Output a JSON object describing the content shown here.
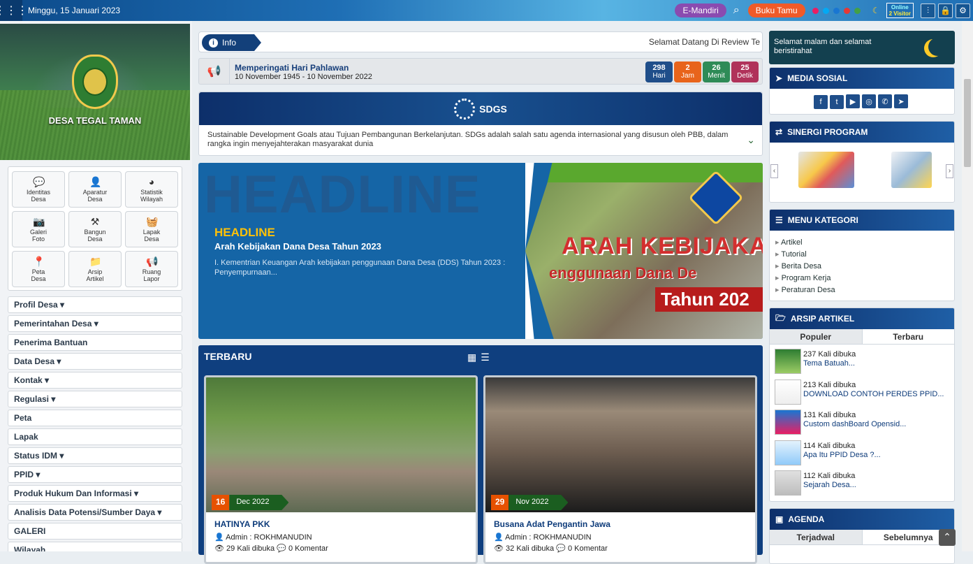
{
  "topbar": {
    "date": "Minggu, 15 Januari 2023",
    "emandiri": "E-Mandiri",
    "buku_tamu": "Buku Tamu",
    "online_label": "Online",
    "online_count": "2 Visitor",
    "dots": [
      "#e91e63",
      "#03a9f4",
      "#1976d2",
      "#e53935",
      "#43a047"
    ]
  },
  "hero": {
    "village_name": "DESA TEGAL TAMAN"
  },
  "icon_menu": [
    {
      "label1": "Identitas",
      "label2": "Desa",
      "icon": "chat-icon",
      "glyph": "💬"
    },
    {
      "label1": "Aparatur",
      "label2": "Desa",
      "icon": "user-icon",
      "glyph": "👤"
    },
    {
      "label1": "Statistik",
      "label2": "Wilayah",
      "icon": "pie-chart-icon",
      "glyph": "◕"
    },
    {
      "label1": "Galeri",
      "label2": "Foto",
      "icon": "camera-icon",
      "glyph": "📷"
    },
    {
      "label1": "Bangun",
      "label2": "Desa",
      "icon": "tools-icon",
      "glyph": "⚒"
    },
    {
      "label1": "Lapak",
      "label2": "Desa",
      "icon": "basket-icon",
      "glyph": "🧺"
    },
    {
      "label1": "Peta",
      "label2": "Desa",
      "icon": "map-pin-icon",
      "glyph": "📍"
    },
    {
      "label1": "Arsip",
      "label2": "Artikel",
      "icon": "folder-icon",
      "glyph": "📁"
    },
    {
      "label1": "Ruang",
      "label2": "Lapor",
      "icon": "megaphone-icon",
      "glyph": "📢"
    }
  ],
  "side_menu": [
    "Profil Desa ▾",
    "Pemerintahan Desa ▾",
    "Penerima Bantuan",
    "Data Desa ▾",
    "Kontak ▾",
    "Regulasi ▾",
    "Peta",
    "Lapak",
    "Status IDM ▾",
    "PPID ▾",
    "Produk Hukum Dan Informasi ▾",
    "Analisis Data Potensi/Sumber Daya ▾",
    "GALERI",
    "Wilayah"
  ],
  "info": {
    "tag": "Info",
    "text": "Selamat Datang Di Review Te"
  },
  "event": {
    "title": "Memperingati Hari Pahlawan",
    "date": "10 November 1945 - 10 November 2022",
    "countdown": [
      {
        "value": "298",
        "unit": "Hari",
        "color": "#1f4e8a"
      },
      {
        "value": "2",
        "unit": "Jam",
        "color": "#e8641b"
      },
      {
        "value": "26",
        "unit": "Menit",
        "color": "#2e8b57"
      },
      {
        "value": "25",
        "unit": "Detik",
        "color": "#b0325a"
      }
    ]
  },
  "sdgs": {
    "title": "SDGS",
    "text": "Sustainable Development Goals atau Tujuan Pembangunan Berkelanjutan. SDGs adalah salah satu agenda internasional yang disusun oleh PBB, dalam rangka ingin menyejahterakan masyarakat dunia"
  },
  "headline": {
    "bg_word": "HEADLINE",
    "tag": "HEADLINE",
    "title": "Arah Kebijakan Dana Desa Tahun 2023",
    "desc": "I. Kementrian Keuangan Arah kebijakan penggunaan Dana Desa (DDS) Tahun 2023 : Penyempurnaan...",
    "img_line1": "ARAH KEBIJAKA",
    "img_line2": "enggunaan Dana De",
    "img_line3": "Tahun 202"
  },
  "terbaru": {
    "title": "TERBARU",
    "cards": [
      {
        "day": "16",
        "month": "Dec 2022",
        "title": "HATINYA PKK",
        "author": "Admin : ROKHMANUDIN",
        "views": "29 Kali dibuka",
        "comments": "0 Komentar"
      },
      {
        "day": "29",
        "month": "Nov 2022",
        "title": "Busana Adat Pengantin Jawa",
        "author": "Admin : ROKHMANUDIN",
        "views": "32 Kali dibuka",
        "comments": "0 Komentar"
      }
    ]
  },
  "greeting": "Selamat malam dan selamat beristirahat",
  "media_sosial": {
    "title": "MEDIA SOSIAL",
    "icons": [
      "f",
      "t",
      "▶",
      "◎",
      "✆",
      "➤"
    ]
  },
  "sinergi": {
    "title": "SINERGI PROGRAM"
  },
  "kategori": {
    "title": "MENU KATEGORI",
    "items": [
      "Artikel",
      "Tutorial",
      "Berita Desa",
      "Program Kerja",
      "Peraturan Desa"
    ]
  },
  "arsip": {
    "title": "ARSIP ARTIKEL",
    "tab_populer": "Populer",
    "tab_terbaru": "Terbaru",
    "items": [
      {
        "count": "237 Kali dibuka",
        "title": "Tema Batuah..."
      },
      {
        "count": "213 Kali dibuka",
        "title": "DOWNLOAD CONTOH PERDES PPID..."
      },
      {
        "count": "131 Kali dibuka",
        "title": "Custom dashBoard Opensid..."
      },
      {
        "count": "114 Kali dibuka",
        "title": "Apa Itu PPID Desa ?..."
      },
      {
        "count": "112 Kali dibuka",
        "title": "Sejarah Desa..."
      }
    ]
  },
  "agenda": {
    "title": "AGENDA",
    "tab1": "Terjadwal",
    "tab2": "Sebelumnya"
  }
}
